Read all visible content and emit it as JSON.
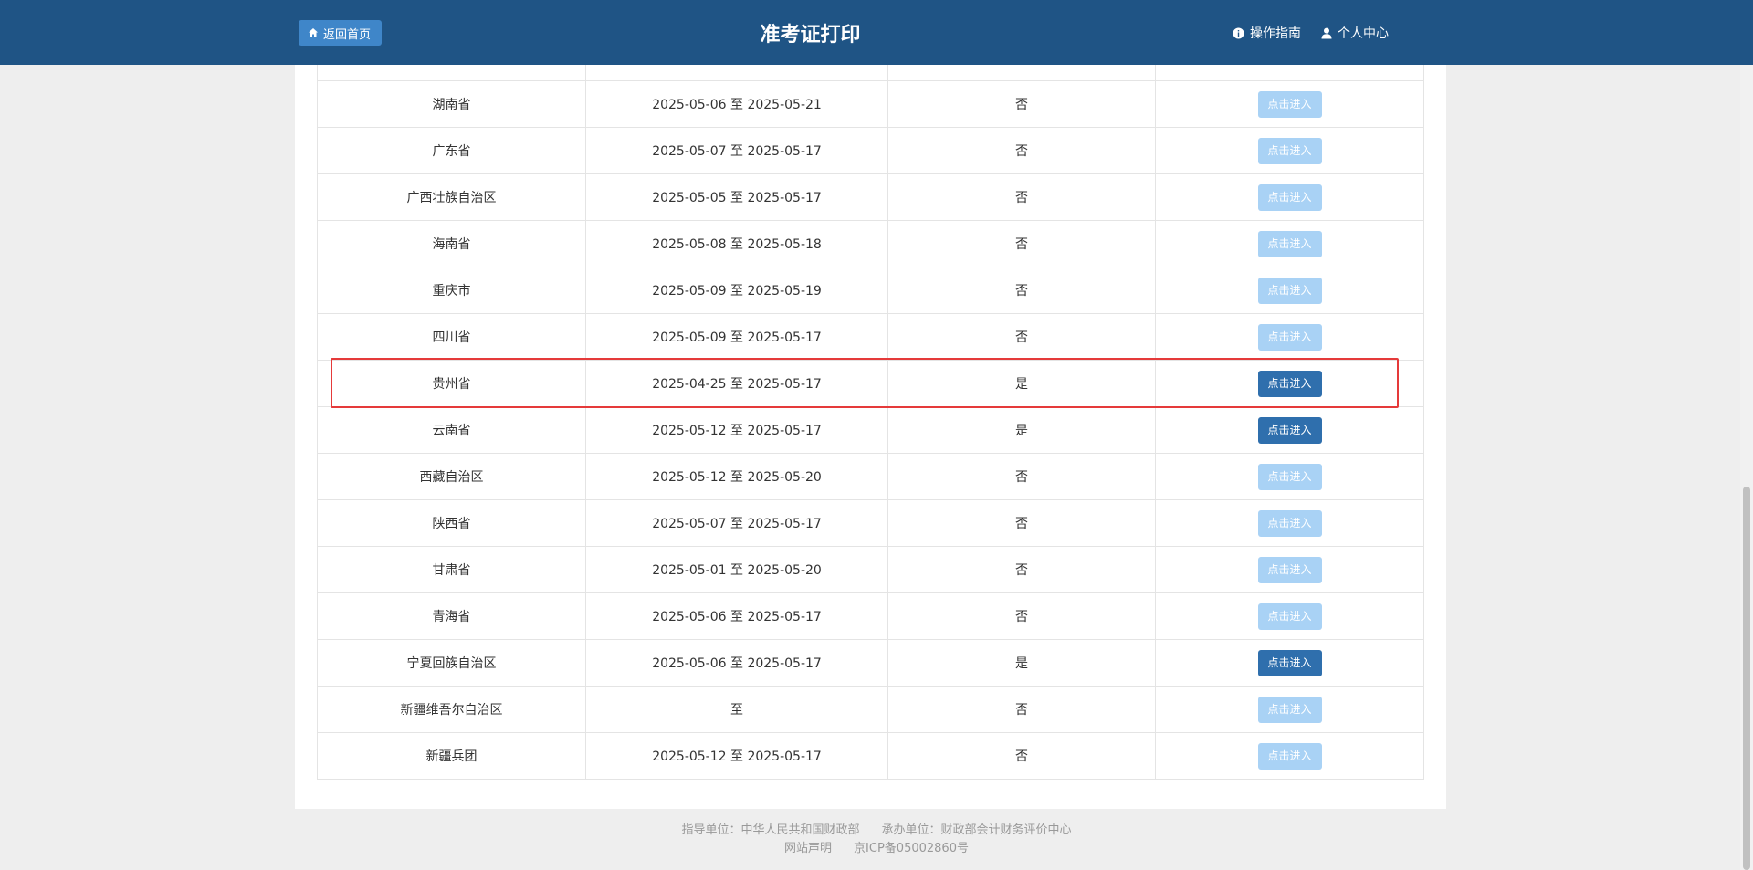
{
  "header": {
    "back_label": "返回首页",
    "title": "准考证打印",
    "guide_label": "操作指南",
    "personal_label": "个人中心"
  },
  "table": {
    "button_label": "点击进入",
    "rows": [
      {
        "province": "",
        "period": "",
        "status": "",
        "enabled": true
      },
      {
        "province": "湖南省",
        "period": "2025-05-06 至 2025-05-21",
        "status": "否",
        "enabled": false
      },
      {
        "province": "广东省",
        "period": "2025-05-07 至 2025-05-17",
        "status": "否",
        "enabled": false
      },
      {
        "province": "广西壮族自治区",
        "period": "2025-05-05 至 2025-05-17",
        "status": "否",
        "enabled": false
      },
      {
        "province": "海南省",
        "period": "2025-05-08 至 2025-05-18",
        "status": "否",
        "enabled": false
      },
      {
        "province": "重庆市",
        "period": "2025-05-09 至 2025-05-19",
        "status": "否",
        "enabled": false
      },
      {
        "province": "四川省",
        "period": "2025-05-09 至 2025-05-17",
        "status": "否",
        "enabled": false
      },
      {
        "province": "贵州省",
        "period": "2025-04-25 至 2025-05-17",
        "status": "是",
        "enabled": true
      },
      {
        "province": "云南省",
        "period": "2025-05-12 至 2025-05-17",
        "status": "是",
        "enabled": true
      },
      {
        "province": "西藏自治区",
        "period": "2025-05-12 至 2025-05-20",
        "status": "否",
        "enabled": false
      },
      {
        "province": "陕西省",
        "period": "2025-05-07 至 2025-05-17",
        "status": "否",
        "enabled": false
      },
      {
        "province": "甘肃省",
        "period": "2025-05-01 至 2025-05-20",
        "status": "否",
        "enabled": false
      },
      {
        "province": "青海省",
        "period": "2025-05-06 至 2025-05-17",
        "status": "否",
        "enabled": false
      },
      {
        "province": "宁夏回族自治区",
        "period": "2025-05-06 至 2025-05-17",
        "status": "是",
        "enabled": true
      },
      {
        "province": "新疆维吾尔自治区",
        "period": "至",
        "status": "否",
        "enabled": false
      },
      {
        "province": "新疆兵团",
        "period": "2025-05-12 至 2025-05-17",
        "status": "否",
        "enabled": false
      }
    ]
  },
  "footer": {
    "guide_unit": "指导单位：中华人民共和国财政部",
    "host_unit": "承办单位：财政部会计财务评价中心",
    "statement": "网站声明",
    "icp": "京ICP备05002860号"
  },
  "colors": {
    "header_bg": "#1f5485",
    "button_enabled": "#2f6fad",
    "button_disabled": "#a9d2f5",
    "highlight": "#e53a3a"
  }
}
